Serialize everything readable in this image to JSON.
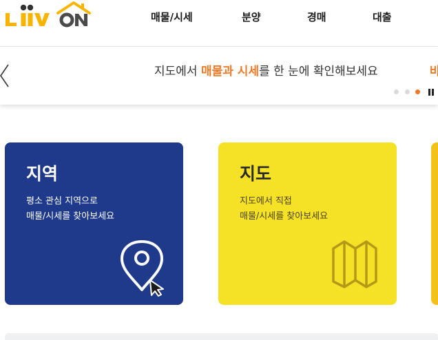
{
  "header": {
    "logo_text": "LiiV ON",
    "nav": [
      "매물/시세",
      "분양",
      "경매",
      "대출"
    ]
  },
  "banner": {
    "text_pre": "지도에서 ",
    "text_highlight": "매물과 시세",
    "text_post": "를 한 눈에 확인해보세요",
    "next_preview": "바",
    "slide_count": 3,
    "active_slide": 3
  },
  "cards": [
    {
      "title": "지역",
      "desc_line1": "평소 관심 지역으로",
      "desc_line2": "매물/시세를 찾아보세요",
      "icon": "location-pin-cursor-icon"
    },
    {
      "title": "지도",
      "desc_line1": "지도에서 직접",
      "desc_line2": "매물/시세를 찾아보세요",
      "icon": "folded-map-icon"
    }
  ],
  "colors": {
    "brand_orange": "#ee7a27",
    "logo_yellow": "#f7b500",
    "region_card": "#1f3a8a",
    "map_card": "#f5e126",
    "third_card": "#f2c218"
  }
}
